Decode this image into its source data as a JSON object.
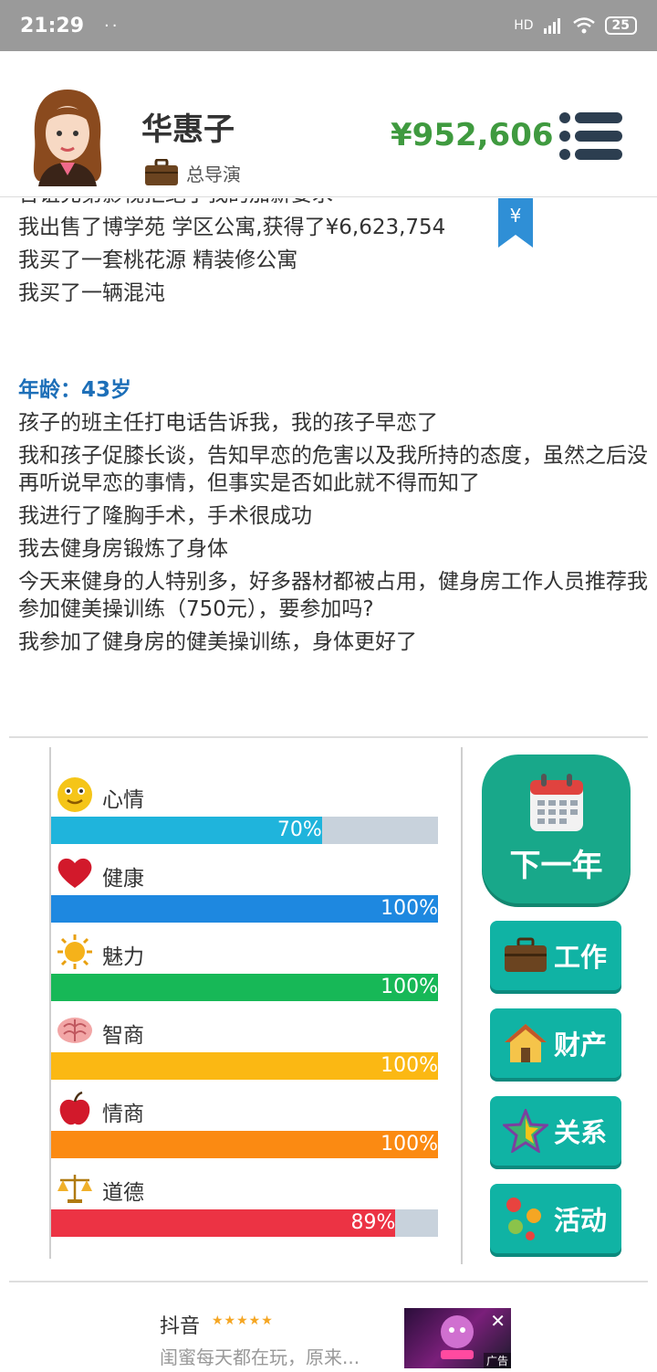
{
  "status_bar": {
    "time": "21:29",
    "dots": "··",
    "network": "HD",
    "battery": "25"
  },
  "profile": {
    "name": "华惠子",
    "job": "总导演",
    "money": "¥952,606"
  },
  "log": {
    "cut_line": "合谊充第影视拒绝了我的加薪要求",
    "lines_top": [
      "我出售了博学苑 学区公寓,获得了¥6,623,754",
      "我买了一套桃花源 精装修公寓",
      "我买了一辆混沌"
    ],
    "age_label": "年龄：43岁",
    "lines": [
      "孩子的班主任打电话告诉我，我的孩子早恋了",
      "我和孩子促膝长谈，告知早恋的危害以及我所持的态度，虽然之后没再听说早恋的事情，但事实是否如此就不得而知了",
      "我进行了隆胸手术，手术很成功",
      "我去健身房锻炼了身体",
      "今天来健身的人特别多，好多器材都被占用，健身房工作人员推荐我参加健美操训练（750元），要参加吗?",
      "我参加了健身房的健美操训练，身体更好了"
    ],
    "ribbon_symbol": "¥"
  },
  "stats": [
    {
      "label": "心情",
      "value": 70,
      "text": "70%",
      "color": "#1fb4dc",
      "icon": "smiley-icon"
    },
    {
      "label": "健康",
      "value": 100,
      "text": "100%",
      "color": "#1e88e0",
      "icon": "heart-icon"
    },
    {
      "label": "魅力",
      "value": 100,
      "text": "100%",
      "color": "#17b857",
      "icon": "sun-icon"
    },
    {
      "label": "智商",
      "value": 100,
      "text": "100%",
      "color": "#fbb813",
      "icon": "brain-icon"
    },
    {
      "label": "情商",
      "value": 100,
      "text": "100%",
      "color": "#fb8a12",
      "icon": "apple-icon"
    },
    {
      "label": "道德",
      "value": 89,
      "text": "89%",
      "color": "#ec3344",
      "icon": "scales-icon"
    }
  ],
  "buttons": {
    "next_year": "下一年",
    "work": "工作",
    "assets": "财产",
    "relations": "关系",
    "activities": "活动"
  },
  "ad": {
    "title": "抖音",
    "stars": "★★★★★",
    "desc": "闺蜜每天都在玩，原来...",
    "close": "✕",
    "tag": "广告"
  }
}
